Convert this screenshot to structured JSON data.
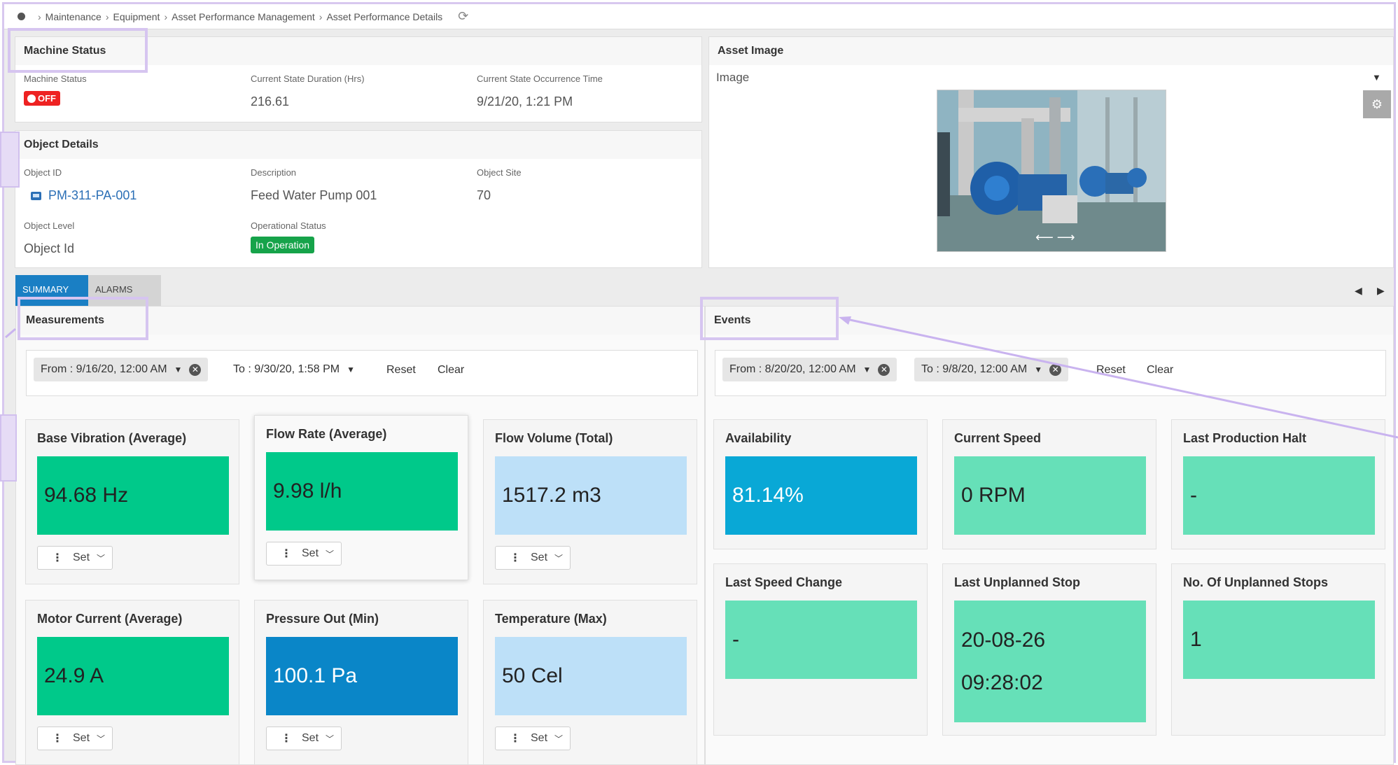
{
  "breadcrumb": [
    "Maintenance",
    "Equipment",
    "Asset Performance Management",
    "Asset Performance Details"
  ],
  "machine_status": {
    "title": "Machine Status",
    "status_label": "Machine Status",
    "status_value": "OFF",
    "duration_label": "Current State Duration (Hrs)",
    "duration_value": "216.61",
    "occurrence_label": "Current State Occurrence Time",
    "occurrence_value": "9/21/20, 1:21 PM"
  },
  "object_details": {
    "title": "Object Details",
    "object_id_label": "Object ID",
    "object_id_value": "PM-311-PA-001",
    "description_label": "Description",
    "description_value": "Feed Water Pump 001",
    "site_label": "Object Site",
    "site_value": "70",
    "level_label": "Object Level",
    "level_value": "Object Id",
    "op_status_label": "Operational Status",
    "op_status_value": "In Operation"
  },
  "asset_image": {
    "title": "Asset Image",
    "select_label": "Image"
  },
  "tabs": [
    {
      "label": "SUMMARY"
    },
    {
      "label": "ALARMS"
    }
  ],
  "measurements": {
    "title": "Measurements",
    "from": "From : 9/16/20, 12:00 AM",
    "to": "To : 9/30/20, 1:58 PM",
    "reset": "Reset",
    "clear": "Clear",
    "cards": [
      {
        "title": "Base Vibration (Average)",
        "value": "94.68 Hz",
        "set": "Set"
      },
      {
        "title": "Flow Rate (Average)",
        "value": "9.98 l/h",
        "set": "Set"
      },
      {
        "title": "Flow Volume (Total)",
        "value": "1517.2 m3",
        "set": "Set"
      },
      {
        "title": "Motor Current (Average)",
        "value": "24.9 A",
        "set": "Set"
      },
      {
        "title": "Pressure Out (Min)",
        "value": "100.1 Pa",
        "set": "Set"
      },
      {
        "title": "Temperature (Max)",
        "value": "50 Cel",
        "set": "Set"
      }
    ]
  },
  "events": {
    "title": "Events",
    "from": "From : 8/20/20, 12:00 AM",
    "to": "To : 9/8/20, 12:00 AM",
    "reset": "Reset",
    "clear": "Clear",
    "cards": [
      {
        "title": "Availability",
        "value": "81.14%"
      },
      {
        "title": "Current Speed",
        "value": "0 RPM"
      },
      {
        "title": "Last Production Halt",
        "value": "-"
      },
      {
        "title": "Last Speed Change",
        "value": "-"
      },
      {
        "title": "Last Unplanned Stop",
        "value_line1": "20-08-26",
        "value_line2": "09:28:02"
      },
      {
        "title": "No. Of Unplanned Stops",
        "value": "1"
      }
    ]
  },
  "colors": {
    "kpi_green": "#00c98a",
    "kpi_light_blue": "#bde0f8",
    "kpi_dark_blue": "#0a86c8",
    "kpi_cyan": "#09a8d6",
    "kpi_mint": "#66e0b8",
    "status_off": "#e22222",
    "status_in_operation": "#16a34a",
    "tab_active": "#1a7fc4",
    "annotation_highlight": "#d6c5f0"
  }
}
